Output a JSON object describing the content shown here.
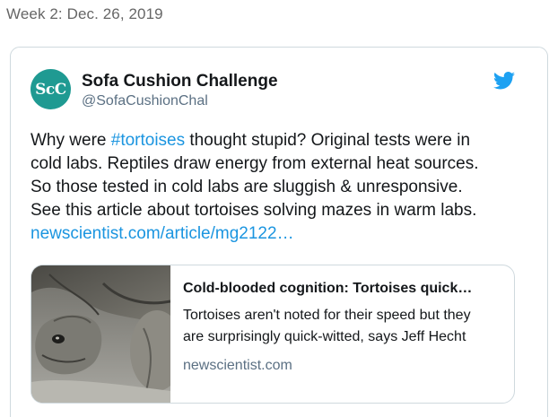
{
  "page": {
    "heading": "Week 2: Dec. 26, 2019"
  },
  "tweet": {
    "avatar_text": "ScC",
    "display_name": "Sofa Cushion Challenge",
    "handle": "@SofaCushionChal",
    "brand_icon": "twitter-bird-icon",
    "accent_color": "#1b95e0",
    "text": {
      "line1_prefix": "Why were ",
      "hashtag": "#tortoises",
      "line1_suffix": " thought stupid? Original tests were in",
      "line2": "cold labs. Reptiles draw energy from external heat sources.",
      "line3": "So those tested in cold labs are sluggish & unresponsive.",
      "line4": "See this article about tortoises solving mazes in warm labs.",
      "link": "newscientist.com/article/mg2122…"
    },
    "link_card": {
      "title": "Cold-blooded cognition: Tortoises quick…",
      "description_line1": "Tortoises aren't noted for their speed but they",
      "description_line2": "are surprisingly quick-witted, says Jeff Hecht",
      "domain": "newscientist.com",
      "thumbnail": "tortoise-photo"
    }
  }
}
